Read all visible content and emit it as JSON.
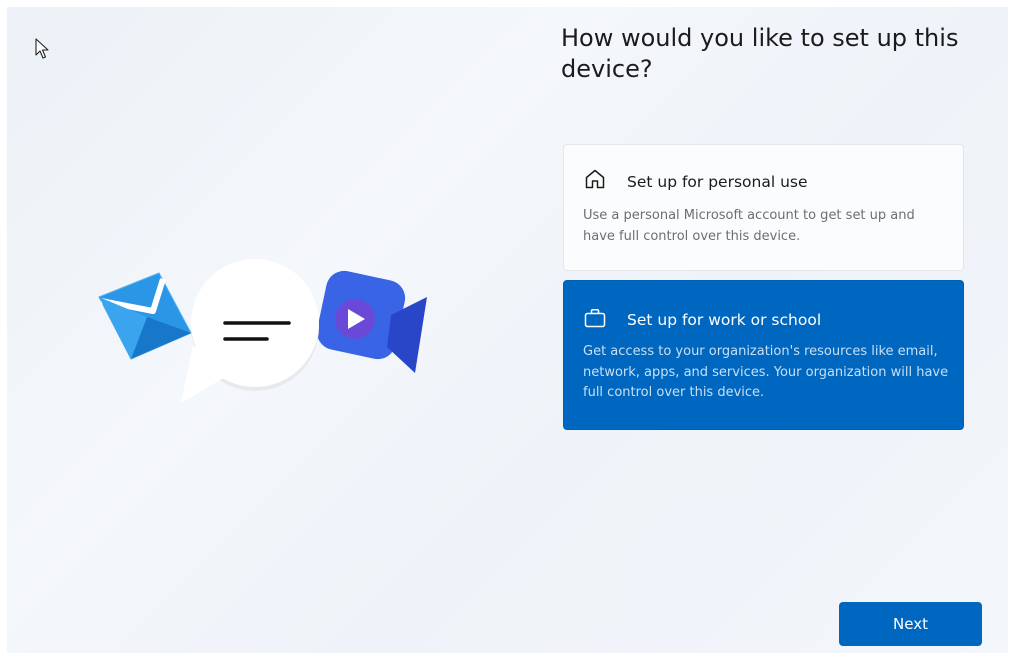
{
  "page": {
    "title": "How would you like to set up this device?"
  },
  "options": [
    {
      "title": "Set up for personal use",
      "description": "Use a personal Microsoft account to get set up and have full control over this device.",
      "icon": "home-icon",
      "selected": false
    },
    {
      "title": "Set up for work or school",
      "description": "Get access to your organization's resources like email, network, apps, and services. Your organization will have full control over this device.",
      "icon": "briefcase-icon",
      "selected": true
    }
  ],
  "footer": {
    "next_label": "Next"
  },
  "illustration": {
    "icons": [
      "mail-icon",
      "chat-bubble-icon",
      "video-camera-icon"
    ]
  },
  "colors": {
    "accent": "#0067c0",
    "selected_card_text": "#ffffff",
    "selected_card_desc": "#c9dff3",
    "card_background": "#fbfcfd",
    "title_text": "#1b1b1b",
    "muted_text": "#6b6f74"
  }
}
